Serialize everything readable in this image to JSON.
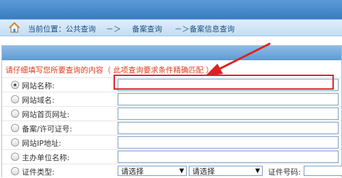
{
  "breadcrumb": {
    "current_location": "当前位置：公共查询",
    "separator_1": "－＞",
    "level_2": "备案查询",
    "separator_2": "－＞",
    "level_3": "备案信息查询"
  },
  "form": {
    "notice": "请仔细填写您所要查询的内容（ 此项查询要求条件精确匹配 ）",
    "fields": [
      {
        "label": "网站名称:",
        "value": "",
        "selected": true
      },
      {
        "label": "网站域名:",
        "value": "",
        "selected": false
      },
      {
        "label": "网站首页网址:",
        "value": "",
        "selected": false
      },
      {
        "label": "备案/许可证号:",
        "value": "",
        "selected": false
      },
      {
        "label": "网站IP地址:",
        "value": "",
        "selected": false
      },
      {
        "label": "主办单位名称:",
        "value": "",
        "selected": false
      }
    ],
    "certificate": {
      "label": "证件类型:",
      "type_select": "请选择",
      "subtype_select": "请选择",
      "number_label": "证件号码:",
      "number_value": ""
    }
  },
  "colors": {
    "header_blue": "#3a7cc2",
    "notice_red": "#e03b1a",
    "highlight_red": "#e02020"
  },
  "icons": {
    "home": "house-icon"
  }
}
